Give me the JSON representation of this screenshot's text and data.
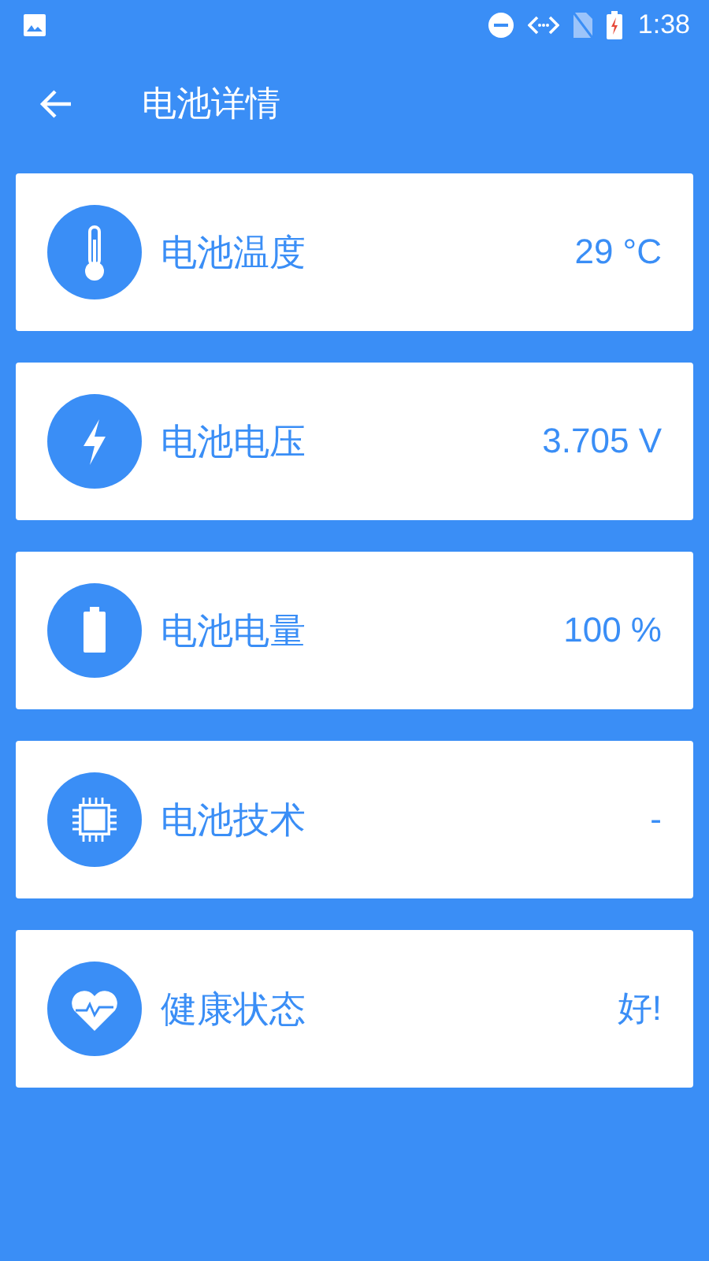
{
  "status_bar": {
    "time": "1:38"
  },
  "toolbar": {
    "title": "电池详情"
  },
  "items": [
    {
      "kind": "temperature",
      "label": "电池温度",
      "value": "29 °C"
    },
    {
      "kind": "voltage",
      "label": "电池电压",
      "value": "3.705 V"
    },
    {
      "kind": "level",
      "label": "电池电量",
      "value": "100 %"
    },
    {
      "kind": "technology",
      "label": "电池技术",
      "value": "-"
    },
    {
      "kind": "health",
      "label": "健康状态",
      "value": "好!"
    }
  ]
}
